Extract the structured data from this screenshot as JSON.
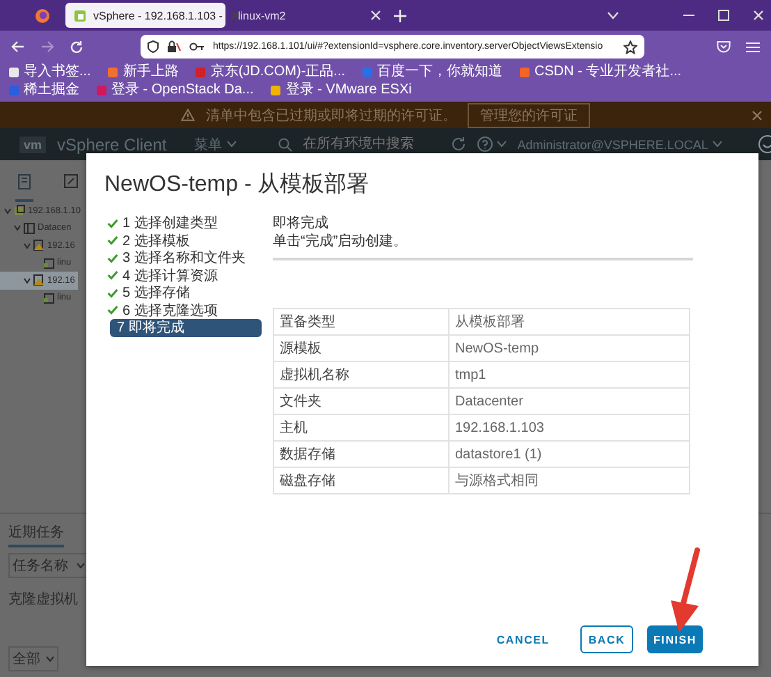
{
  "browser": {
    "tabs": [
      {
        "label": "vSphere - 192.168.1.103 -",
        "selected": true
      },
      {
        "label": "linux-vm2",
        "selected": false
      }
    ],
    "url": "https://192.168.1.101/ui/#?extensionId=vsphere.core.inventory.serverObjectViewsExtensio"
  },
  "bookmarks": [
    "导入书签...",
    "新手上路",
    "京东(JD.COM)-正品...",
    "百度一下，你就知道",
    "CSDN - 专业开发者社...",
    "稀土掘金",
    "登录 - OpenStack Da...",
    "登录 - VMware ESXi"
  ],
  "banner": {
    "message": "清单中包含已过期或即将过期的许可证。",
    "action": "管理您的许可证"
  },
  "app_header": {
    "logo": "vm",
    "title": "vSphere Client",
    "menu": "菜单",
    "search_placeholder": "在所有环境中搜索",
    "user": "Administrator@VSPHERE.LOCAL"
  },
  "inventory": {
    "tree": [
      {
        "label": "192.168.1.10",
        "expanded": true,
        "selected": false,
        "children": [
          {
            "label": "Datacen",
            "expanded": true,
            "selected": false,
            "children": [
              {
                "label": "192.16",
                "expanded": true,
                "selected": false,
                "children": [
                  {
                    "label": "linu",
                    "selected": false
                  }
                ]
              },
              {
                "label": "192.16",
                "expanded": true,
                "selected": true,
                "children": [
                  {
                    "label": "linu",
                    "selected": false
                  }
                ]
              }
            ]
          }
        ]
      }
    ]
  },
  "recent_tasks": {
    "tab": "近期任务",
    "column": "任务名称",
    "rows": [
      "克隆虚拟机"
    ],
    "filter": "全部"
  },
  "wizard": {
    "title": "NewOS-temp - 从模板部署",
    "steps": [
      {
        "label": "1 选择创建类型",
        "done": true,
        "selected": false
      },
      {
        "label": "2 选择模板",
        "done": true,
        "selected": false
      },
      {
        "label": "3 选择名称和文件夹",
        "done": true,
        "selected": false
      },
      {
        "label": "4 选择计算资源",
        "done": true,
        "selected": false
      },
      {
        "label": "5 选择存储",
        "done": true,
        "selected": false
      },
      {
        "label": "6 选择克隆选项",
        "done": true,
        "selected": false
      },
      {
        "label": "7 即将完成",
        "done": false,
        "selected": true
      }
    ],
    "heading": "即将完成",
    "subtitle": "单击“完成”启动创建。",
    "rows": [
      {
        "label": "置备类型",
        "value": "从模板部署"
      },
      {
        "label": "源模板",
        "value": "NewOS-temp"
      },
      {
        "label": "虚拟机名称",
        "value": "tmp1"
      },
      {
        "label": "文件夹",
        "value": "Datacenter"
      },
      {
        "label": "主机",
        "value": "192.168.1.103"
      },
      {
        "label": "数据存储",
        "value": "datastore1 (1)"
      },
      {
        "label": "磁盘存储",
        "value": "与源格式相同"
      }
    ],
    "buttons": [
      {
        "label": "CANCEL",
        "kind": "link"
      },
      {
        "label": "BACK",
        "kind": "outline"
      },
      {
        "label": "FINISH",
        "kind": "primary"
      }
    ]
  }
}
